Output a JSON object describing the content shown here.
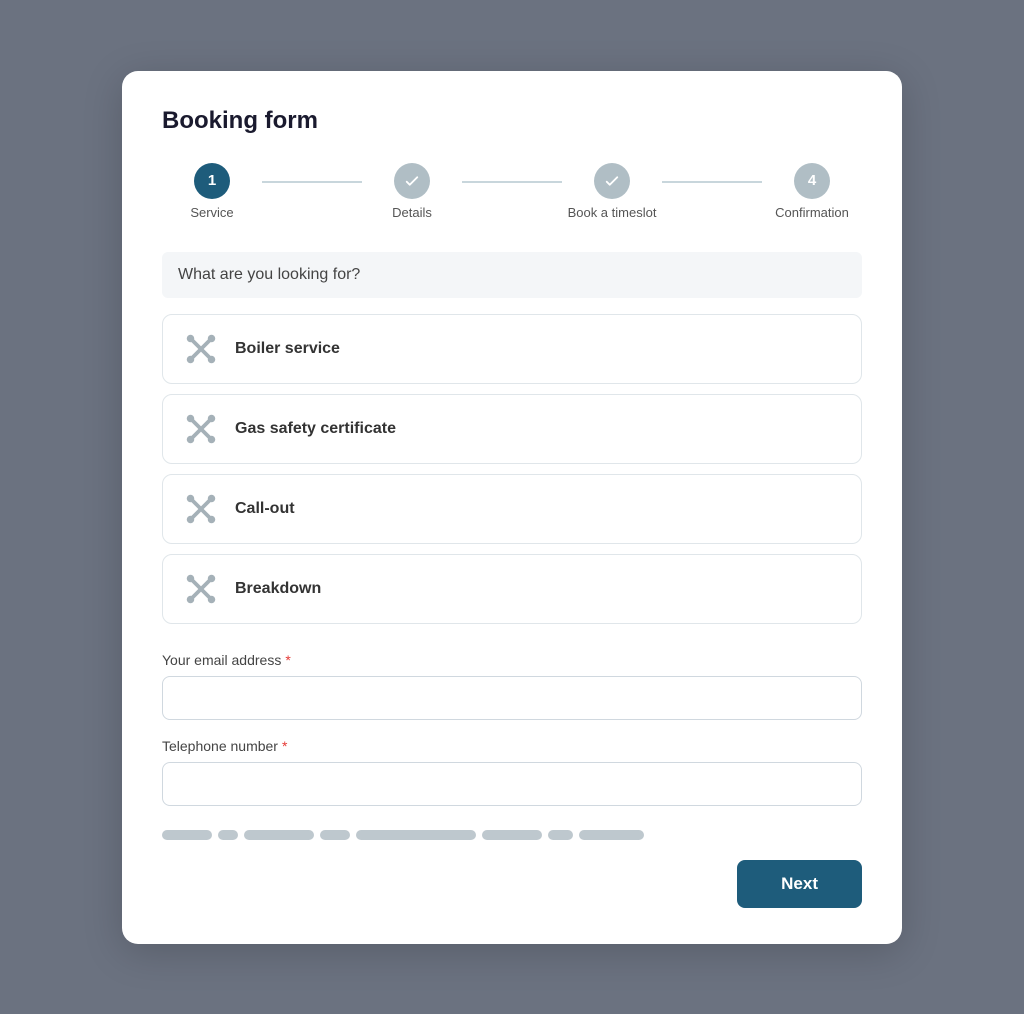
{
  "title": "Booking form",
  "stepper": {
    "steps": [
      {
        "id": "service",
        "label": "Service",
        "number": "1",
        "state": "active"
      },
      {
        "id": "details",
        "label": "Details",
        "number": "✓",
        "state": "done"
      },
      {
        "id": "timeslot",
        "label": "Book a timeslot",
        "number": "✓",
        "state": "done"
      },
      {
        "id": "confirmation",
        "label": "Confirmation",
        "number": "4",
        "state": "inactive"
      }
    ]
  },
  "question": "What are you looking for?",
  "services": [
    {
      "id": "boiler",
      "label": "Boiler service"
    },
    {
      "id": "gas",
      "label": "Gas safety certificate"
    },
    {
      "id": "callout",
      "label": "Call-out"
    },
    {
      "id": "breakdown",
      "label": "Breakdown"
    }
  ],
  "email_label": "Your email address",
  "email_placeholder": "",
  "phone_label": "Telephone number",
  "phone_placeholder": "",
  "required_marker": "*",
  "next_button": "Next",
  "dashes": [
    50,
    20,
    70,
    30,
    120,
    60,
    25,
    65
  ]
}
